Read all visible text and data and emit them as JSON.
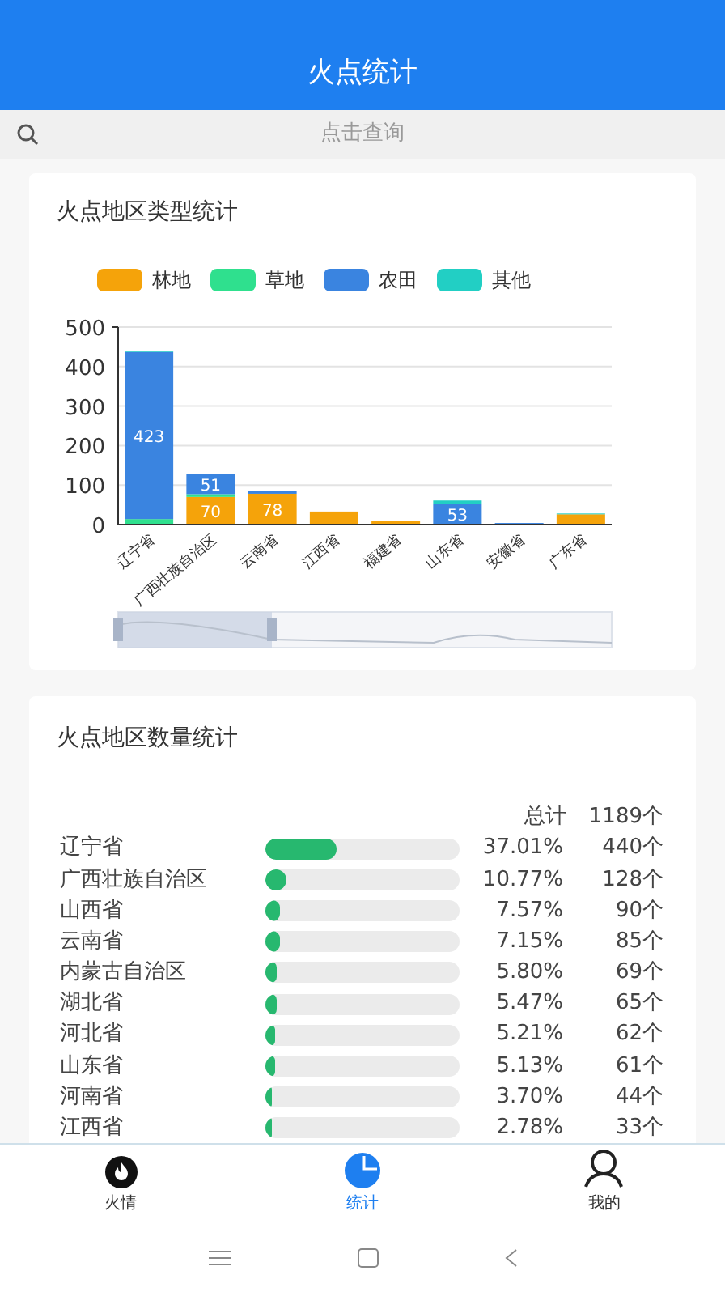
{
  "header": {
    "title": "火点统计"
  },
  "search": {
    "placeholder": "点击查询"
  },
  "type_card": {
    "title": "火点地区类型统计",
    "chart_data": {
      "type": "bar",
      "stacked": true,
      "grid": true,
      "categories": [
        "辽宁省",
        "广西壮族自治区",
        "云南省",
        "江西省",
        "福建省",
        "山东省",
        "安徽省",
        "广东省"
      ],
      "series": [
        {
          "name": "林地",
          "color": "#f5a30a",
          "values": [
            null,
            70,
            78,
            33,
            10,
            null,
            null,
            26
          ],
          "value_labels": [
            null,
            "70",
            "78",
            null,
            null,
            null,
            null,
            null
          ]
        },
        {
          "name": "草地",
          "color": "#2fe08e",
          "values": [
            14,
            7,
            null,
            null,
            null,
            null,
            null,
            null
          ],
          "value_labels": [
            null,
            null,
            null,
            null,
            null,
            null,
            null,
            null
          ]
        },
        {
          "name": "农田",
          "color": "#3a84e0",
          "values": [
            423,
            51,
            7,
            null,
            null,
            53,
            4,
            null
          ],
          "value_labels": [
            "423",
            "51",
            null,
            null,
            null,
            "53",
            null,
            null
          ]
        },
        {
          "name": "其他",
          "color": "#22cfc4",
          "values": [
            3,
            null,
            null,
            null,
            null,
            8,
            null,
            2
          ],
          "value_labels": [
            null,
            null,
            null,
            null,
            null,
            null,
            null,
            null
          ]
        }
      ],
      "ylim": [
        0,
        500
      ],
      "yticks": [
        0,
        100,
        200,
        300,
        400,
        500
      ]
    }
  },
  "count_card": {
    "title": "火点地区数量统计",
    "total_label": "总计",
    "total": "1189个",
    "rows": [
      {
        "name": "辽宁省",
        "level": 0.3701,
        "percent": "37.01%",
        "count": "440个"
      },
      {
        "name": "广西壮族自治区",
        "level": 0.1077,
        "percent": "10.77%",
        "count": "128个"
      },
      {
        "name": "山西省",
        "level": 0.0757,
        "percent": "7.57%",
        "count": "90个"
      },
      {
        "name": "云南省",
        "level": 0.0715,
        "percent": "7.15%",
        "count": "85个"
      },
      {
        "name": "内蒙古自治区",
        "level": 0.058,
        "percent": "5.80%",
        "count": "69个"
      },
      {
        "name": "湖北省",
        "level": 0.0547,
        "percent": "5.47%",
        "count": "65个"
      },
      {
        "name": "河北省",
        "level": 0.0521,
        "percent": "5.21%",
        "count": "62个"
      },
      {
        "name": "山东省",
        "level": 0.0513,
        "percent": "5.13%",
        "count": "61个"
      },
      {
        "name": "河南省",
        "level": 0.037,
        "percent": "3.70%",
        "count": "44个"
      },
      {
        "name": "江西省",
        "level": 0.0278,
        "percent": "2.78%",
        "count": "33个"
      }
    ]
  },
  "tab_bar": [
    {
      "kind": "fire",
      "label": "火情",
      "selected": false
    },
    {
      "kind": "stats",
      "label": "统计",
      "selected": true
    },
    {
      "kind": "user",
      "label": "我的",
      "selected": false
    }
  ]
}
